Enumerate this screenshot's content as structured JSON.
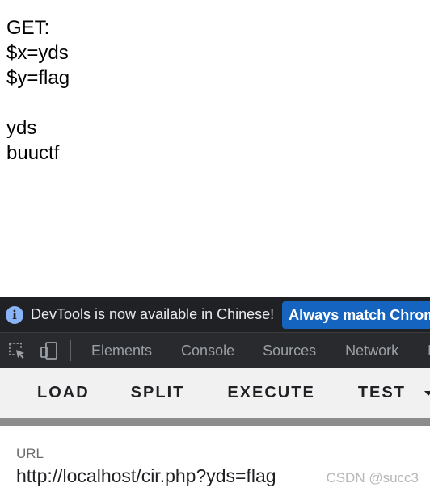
{
  "page": {
    "lines": [
      "GET:",
      "$x=yds",
      "$y=flag",
      "",
      "yds",
      "buuctf"
    ]
  },
  "devtools_banner": {
    "icon": "info-icon",
    "message": "DevTools is now available in Chinese!",
    "button_label": "Always match Chrome's"
  },
  "devtools_tabs": {
    "icons": [
      "inspect-element-icon",
      "device-toggle-icon"
    ],
    "elements": "Elements",
    "console": "Console",
    "sources": "Sources",
    "network": "Network",
    "more": "P"
  },
  "hackbar": {
    "load": "LOAD",
    "split": "SPLIT",
    "execute": "EXECUTE",
    "test": "TEST"
  },
  "url_field": {
    "label": "URL",
    "value": "http://localhost/cir.php?yds=flag"
  },
  "watermark": "CSDN @succ3",
  "colors": {
    "banner_bg": "#202124",
    "banner_button": "#1565c0",
    "tabbar_bg": "#292a2d",
    "hackbar_bg": "#f1f1f1"
  }
}
